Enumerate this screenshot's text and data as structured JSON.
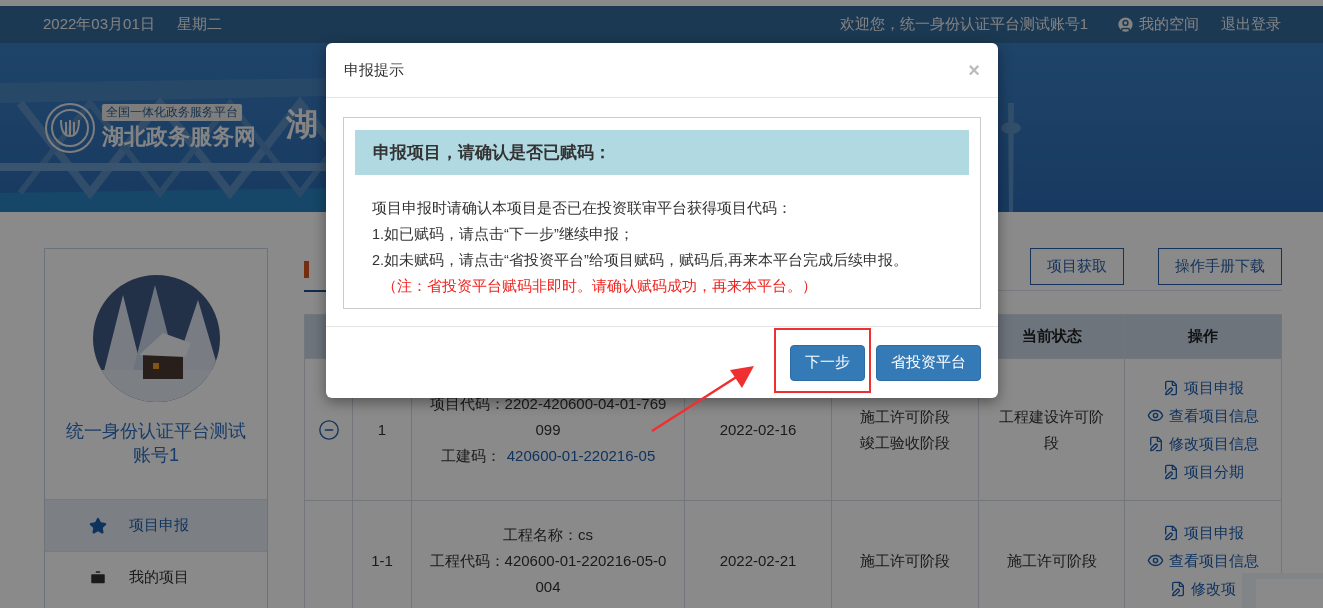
{
  "top_bar": {
    "date": "2022年03月01日",
    "weekday": "星期二",
    "welcome": "欢迎您，统一身份认证平台测试账号1",
    "my_space": "我的空间",
    "logout": "退出登录"
  },
  "banner": {
    "logo_tag": "全国一体化政务服务平台",
    "logo_name": "湖北政务服务网",
    "title": "湖"
  },
  "sidebar": {
    "user_name": "统一身份认证平台测试账号1",
    "menu": [
      {
        "label": "项目申报",
        "kind": "star",
        "selected": true
      },
      {
        "label": "我的项目",
        "kind": "case",
        "selected": false
      }
    ]
  },
  "toolbar": {
    "buttons": [
      "项目获取",
      "操作手册下载"
    ]
  },
  "table": {
    "columns": [
      {
        "label": "当前状态"
      },
      {
        "label": "操作"
      }
    ],
    "rows": [
      {
        "expanded": true,
        "number": "1",
        "info": [
          {
            "text": "项目代码：2202-420600-04-01-769"
          },
          {
            "text": "099"
          },
          {
            "text": "工建码：",
            "link": "420600-01-220216-05"
          }
        ],
        "date": "2022-02-16",
        "stages": [
          "施工许可阶段",
          "竣工验收阶段"
        ],
        "status": "工程建设许可阶段",
        "actions": [
          {
            "kind": "form",
            "label": "项目申报"
          },
          {
            "kind": "eye",
            "label": "查看项目信息"
          },
          {
            "kind": "form",
            "label": "修改项目信息"
          },
          {
            "kind": "form",
            "label": "项目分期"
          }
        ]
      },
      {
        "number": "1-1",
        "info": [
          {
            "text": "工程名称：cs"
          },
          {
            "text": "工程代码：420600-01-220216-05-0"
          },
          {
            "text": "004"
          }
        ],
        "date": "2022-02-21",
        "stages": [
          "施工许可阶段"
        ],
        "status": "施工许可阶段",
        "actions": [
          {
            "kind": "form",
            "label": "项目申报"
          },
          {
            "kind": "eye",
            "label": "查看项目信息"
          },
          {
            "kind": "form",
            "label": "修改项"
          }
        ]
      }
    ]
  },
  "dialog": {
    "title": "申报提示",
    "close": "×",
    "heading": "申报项目，请确认是否已赋码：",
    "lines": [
      {
        "text": "项目申报时请确认本项目是否已在投资联审平台获得项目代码：",
        "kind": "normal"
      },
      {
        "text": "1.如已赋码，请点击“下一步”继续申报；",
        "kind": "normal"
      },
      {
        "text": "2.如未赋码，请点击“省投资平台”给项目赋码，赋码后,再来本平台完成后续申报。",
        "kind": "normal"
      },
      {
        "text": "（注：省投资平台赋码非即时。请确认赋码成功，再来本平台。）",
        "kind": "note"
      }
    ],
    "buttons": [
      {
        "label": "下一步",
        "highlighted": true
      },
      {
        "label": "省投资平台",
        "highlighted": false
      }
    ]
  }
}
